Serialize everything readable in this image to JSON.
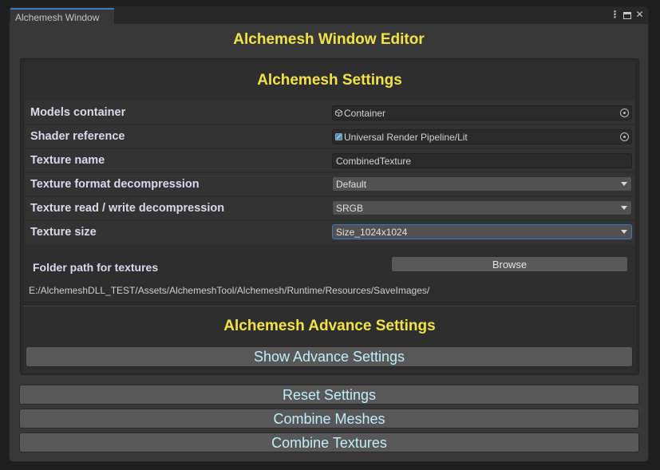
{
  "tab": {
    "label": "Alchemesh Window"
  },
  "window_controls": [
    "menu-icon",
    "maximize-icon",
    "close-icon"
  ],
  "title": "Alchemesh Window Editor",
  "settings": {
    "title": "Alchemesh Settings",
    "models_container": {
      "label": "Models container",
      "value": "Container"
    },
    "shader_reference": {
      "label": "Shader reference",
      "value": "Universal Render Pipeline/Lit"
    },
    "texture_name": {
      "label": "Texture name",
      "value": "CombinedTexture"
    },
    "texture_format": {
      "label": "Texture format decompression",
      "value": "Default"
    },
    "texture_rw": {
      "label": "Texture read / write decompression",
      "value": "SRGB"
    },
    "texture_size": {
      "label": "Texture size",
      "value": "Size_1024x1024"
    },
    "folder": {
      "label": "Folder path for textures",
      "browse_label": "Browse",
      "path": "E:/AlchemeshDLL_TEST/Assets/AlchemeshTool/Alchemesh/Runtime/Resources/SaveImages/"
    }
  },
  "advance": {
    "title": "Alchemesh Advance Settings",
    "show_label": "Show Advance Settings"
  },
  "actions": {
    "reset": "Reset Settings",
    "combine_meshes": "Combine Meshes",
    "combine_textures": "Combine Textures"
  },
  "colors": {
    "accent_title": "#f2e24a",
    "button_text": "#bfeefa",
    "focus": "#3a79bb"
  }
}
